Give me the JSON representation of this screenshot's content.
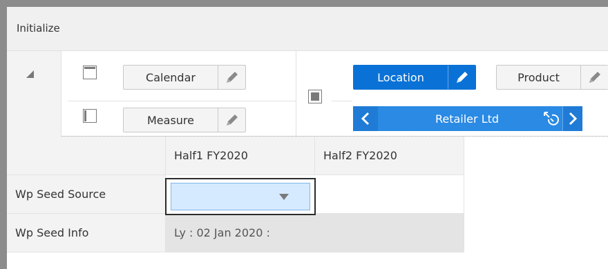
{
  "window": {
    "title": "Initialize"
  },
  "toolbar": {
    "calendar_label": "Calendar",
    "measure_label": "Measure",
    "location_label": "Location",
    "product_label": "Product",
    "pager_member": "Retailer Ltd",
    "active_color": "#0a72d6",
    "icons": {
      "collapse": "collapse-triangle-icon",
      "layout_top": "layout-row-icon",
      "layout_left": "layout-column-icon",
      "layout_page": "layout-page-icon",
      "edit": "pencil-icon",
      "prev": "chevron-left-icon",
      "next": "chevron-right-icon",
      "reset": "reset-pointer-icon"
    }
  },
  "grid": {
    "columns": [
      "Half1 FY2020",
      "Half2 FY2020"
    ],
    "rows": [
      {
        "label": "Wp Seed Source",
        "values": [
          "",
          ""
        ]
      },
      {
        "label": "Wp Seed Info",
        "values": [
          "Ly : 02 Jan 2020 :",
          ""
        ]
      }
    ]
  }
}
